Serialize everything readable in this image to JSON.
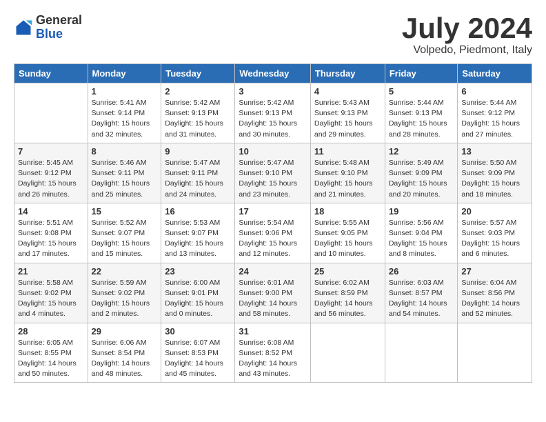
{
  "logo": {
    "general": "General",
    "blue": "Blue"
  },
  "title": "July 2024",
  "location": "Volpedo, Piedmont, Italy",
  "days_of_week": [
    "Sunday",
    "Monday",
    "Tuesday",
    "Wednesday",
    "Thursday",
    "Friday",
    "Saturday"
  ],
  "weeks": [
    [
      {
        "day": "",
        "sunrise": "",
        "sunset": "",
        "daylight": ""
      },
      {
        "day": "1",
        "sunrise": "Sunrise: 5:41 AM",
        "sunset": "Sunset: 9:14 PM",
        "daylight": "Daylight: 15 hours and 32 minutes."
      },
      {
        "day": "2",
        "sunrise": "Sunrise: 5:42 AM",
        "sunset": "Sunset: 9:13 PM",
        "daylight": "Daylight: 15 hours and 31 minutes."
      },
      {
        "day": "3",
        "sunrise": "Sunrise: 5:42 AM",
        "sunset": "Sunset: 9:13 PM",
        "daylight": "Daylight: 15 hours and 30 minutes."
      },
      {
        "day": "4",
        "sunrise": "Sunrise: 5:43 AM",
        "sunset": "Sunset: 9:13 PM",
        "daylight": "Daylight: 15 hours and 29 minutes."
      },
      {
        "day": "5",
        "sunrise": "Sunrise: 5:44 AM",
        "sunset": "Sunset: 9:13 PM",
        "daylight": "Daylight: 15 hours and 28 minutes."
      },
      {
        "day": "6",
        "sunrise": "Sunrise: 5:44 AM",
        "sunset": "Sunset: 9:12 PM",
        "daylight": "Daylight: 15 hours and 27 minutes."
      }
    ],
    [
      {
        "day": "7",
        "sunrise": "Sunrise: 5:45 AM",
        "sunset": "Sunset: 9:12 PM",
        "daylight": "Daylight: 15 hours and 26 minutes."
      },
      {
        "day": "8",
        "sunrise": "Sunrise: 5:46 AM",
        "sunset": "Sunset: 9:11 PM",
        "daylight": "Daylight: 15 hours and 25 minutes."
      },
      {
        "day": "9",
        "sunrise": "Sunrise: 5:47 AM",
        "sunset": "Sunset: 9:11 PM",
        "daylight": "Daylight: 15 hours and 24 minutes."
      },
      {
        "day": "10",
        "sunrise": "Sunrise: 5:47 AM",
        "sunset": "Sunset: 9:10 PM",
        "daylight": "Daylight: 15 hours and 23 minutes."
      },
      {
        "day": "11",
        "sunrise": "Sunrise: 5:48 AM",
        "sunset": "Sunset: 9:10 PM",
        "daylight": "Daylight: 15 hours and 21 minutes."
      },
      {
        "day": "12",
        "sunrise": "Sunrise: 5:49 AM",
        "sunset": "Sunset: 9:09 PM",
        "daylight": "Daylight: 15 hours and 20 minutes."
      },
      {
        "day": "13",
        "sunrise": "Sunrise: 5:50 AM",
        "sunset": "Sunset: 9:09 PM",
        "daylight": "Daylight: 15 hours and 18 minutes."
      }
    ],
    [
      {
        "day": "14",
        "sunrise": "Sunrise: 5:51 AM",
        "sunset": "Sunset: 9:08 PM",
        "daylight": "Daylight: 15 hours and 17 minutes."
      },
      {
        "day": "15",
        "sunrise": "Sunrise: 5:52 AM",
        "sunset": "Sunset: 9:07 PM",
        "daylight": "Daylight: 15 hours and 15 minutes."
      },
      {
        "day": "16",
        "sunrise": "Sunrise: 5:53 AM",
        "sunset": "Sunset: 9:07 PM",
        "daylight": "Daylight: 15 hours and 13 minutes."
      },
      {
        "day": "17",
        "sunrise": "Sunrise: 5:54 AM",
        "sunset": "Sunset: 9:06 PM",
        "daylight": "Daylight: 15 hours and 12 minutes."
      },
      {
        "day": "18",
        "sunrise": "Sunrise: 5:55 AM",
        "sunset": "Sunset: 9:05 PM",
        "daylight": "Daylight: 15 hours and 10 minutes."
      },
      {
        "day": "19",
        "sunrise": "Sunrise: 5:56 AM",
        "sunset": "Sunset: 9:04 PM",
        "daylight": "Daylight: 15 hours and 8 minutes."
      },
      {
        "day": "20",
        "sunrise": "Sunrise: 5:57 AM",
        "sunset": "Sunset: 9:03 PM",
        "daylight": "Daylight: 15 hours and 6 minutes."
      }
    ],
    [
      {
        "day": "21",
        "sunrise": "Sunrise: 5:58 AM",
        "sunset": "Sunset: 9:02 PM",
        "daylight": "Daylight: 15 hours and 4 minutes."
      },
      {
        "day": "22",
        "sunrise": "Sunrise: 5:59 AM",
        "sunset": "Sunset: 9:02 PM",
        "daylight": "Daylight: 15 hours and 2 minutes."
      },
      {
        "day": "23",
        "sunrise": "Sunrise: 6:00 AM",
        "sunset": "Sunset: 9:01 PM",
        "daylight": "Daylight: 15 hours and 0 minutes."
      },
      {
        "day": "24",
        "sunrise": "Sunrise: 6:01 AM",
        "sunset": "Sunset: 9:00 PM",
        "daylight": "Daylight: 14 hours and 58 minutes."
      },
      {
        "day": "25",
        "sunrise": "Sunrise: 6:02 AM",
        "sunset": "Sunset: 8:59 PM",
        "daylight": "Daylight: 14 hours and 56 minutes."
      },
      {
        "day": "26",
        "sunrise": "Sunrise: 6:03 AM",
        "sunset": "Sunset: 8:57 PM",
        "daylight": "Daylight: 14 hours and 54 minutes."
      },
      {
        "day": "27",
        "sunrise": "Sunrise: 6:04 AM",
        "sunset": "Sunset: 8:56 PM",
        "daylight": "Daylight: 14 hours and 52 minutes."
      }
    ],
    [
      {
        "day": "28",
        "sunrise": "Sunrise: 6:05 AM",
        "sunset": "Sunset: 8:55 PM",
        "daylight": "Daylight: 14 hours and 50 minutes."
      },
      {
        "day": "29",
        "sunrise": "Sunrise: 6:06 AM",
        "sunset": "Sunset: 8:54 PM",
        "daylight": "Daylight: 14 hours and 48 minutes."
      },
      {
        "day": "30",
        "sunrise": "Sunrise: 6:07 AM",
        "sunset": "Sunset: 8:53 PM",
        "daylight": "Daylight: 14 hours and 45 minutes."
      },
      {
        "day": "31",
        "sunrise": "Sunrise: 6:08 AM",
        "sunset": "Sunset: 8:52 PM",
        "daylight": "Daylight: 14 hours and 43 minutes."
      },
      {
        "day": "",
        "sunrise": "",
        "sunset": "",
        "daylight": ""
      },
      {
        "day": "",
        "sunrise": "",
        "sunset": "",
        "daylight": ""
      },
      {
        "day": "",
        "sunrise": "",
        "sunset": "",
        "daylight": ""
      }
    ]
  ]
}
